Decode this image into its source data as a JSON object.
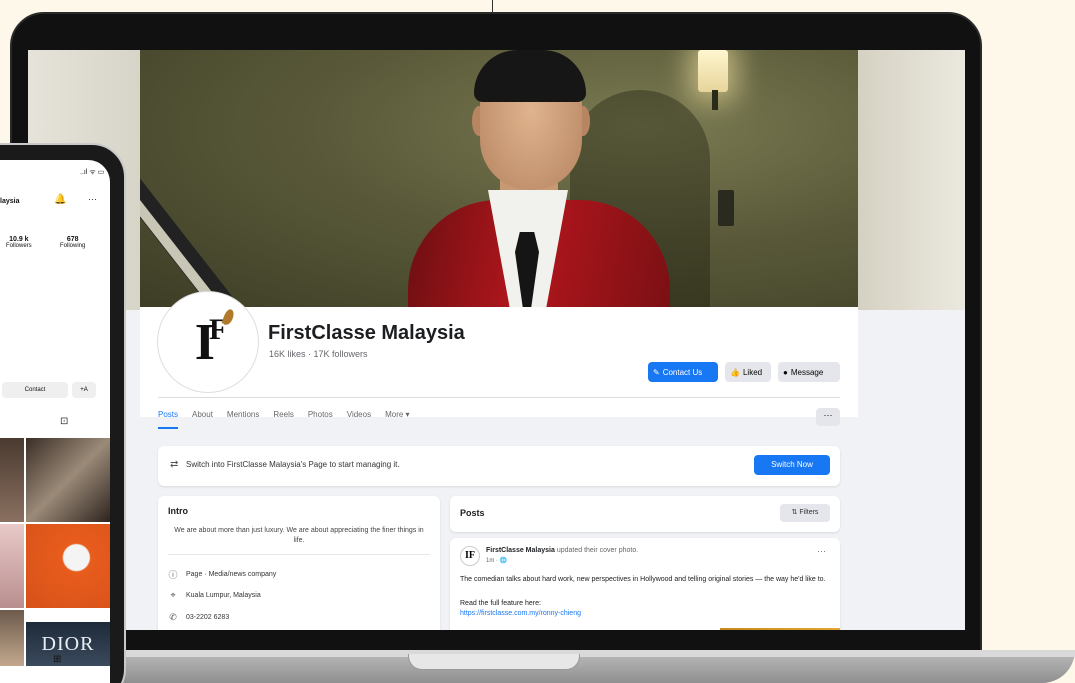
{
  "facebook": {
    "page_name": "FirstClasse Malaysia",
    "page_stats": "16K likes · 17K followers",
    "buttons": {
      "contact": "Contact Us",
      "liked": "Liked",
      "message": "Message"
    },
    "tabs": [
      "Posts",
      "About",
      "Mentions",
      "Reels",
      "Photos",
      "Videos",
      "More ▾"
    ],
    "more_dots": "···",
    "switch_prompt": "Switch into FirstClasse Malaysia's Page to start managing it.",
    "switch_button": "Switch Now",
    "intro": {
      "title": "Intro",
      "bio": "We are about more than just luxury. We are about appreciating the finer things in life.",
      "items": [
        {
          "icon": "info-icon",
          "text": "Page · Media/news company"
        },
        {
          "icon": "location-icon",
          "text": "Kuala Lumpur, Malaysia"
        },
        {
          "icon": "phone-icon",
          "text": "03-2202 6283"
        }
      ]
    },
    "posts": {
      "title": "Posts",
      "filters_label": "Filters",
      "post": {
        "author": "FirstClasse Malaysia",
        "action": "updated their cover photo.",
        "time": "1m · 🌐",
        "text": "The comedian talks about hard work, new perspectives in Hollywood and telling original stories — the way he'd like to.",
        "read_more": "Read the full feature here:",
        "link": "https://firstclasse.com.my/ronny-chieng"
      }
    }
  },
  "instagram": {
    "status": "..ıl ᯤ ▭",
    "name": "laysia",
    "followers_count": "10.9 k",
    "followers_label": "Followers",
    "following_count": "678",
    "following_label": "Following",
    "contact_label": "Contact",
    "add_label": "+A",
    "grid_text": "DIOR"
  }
}
